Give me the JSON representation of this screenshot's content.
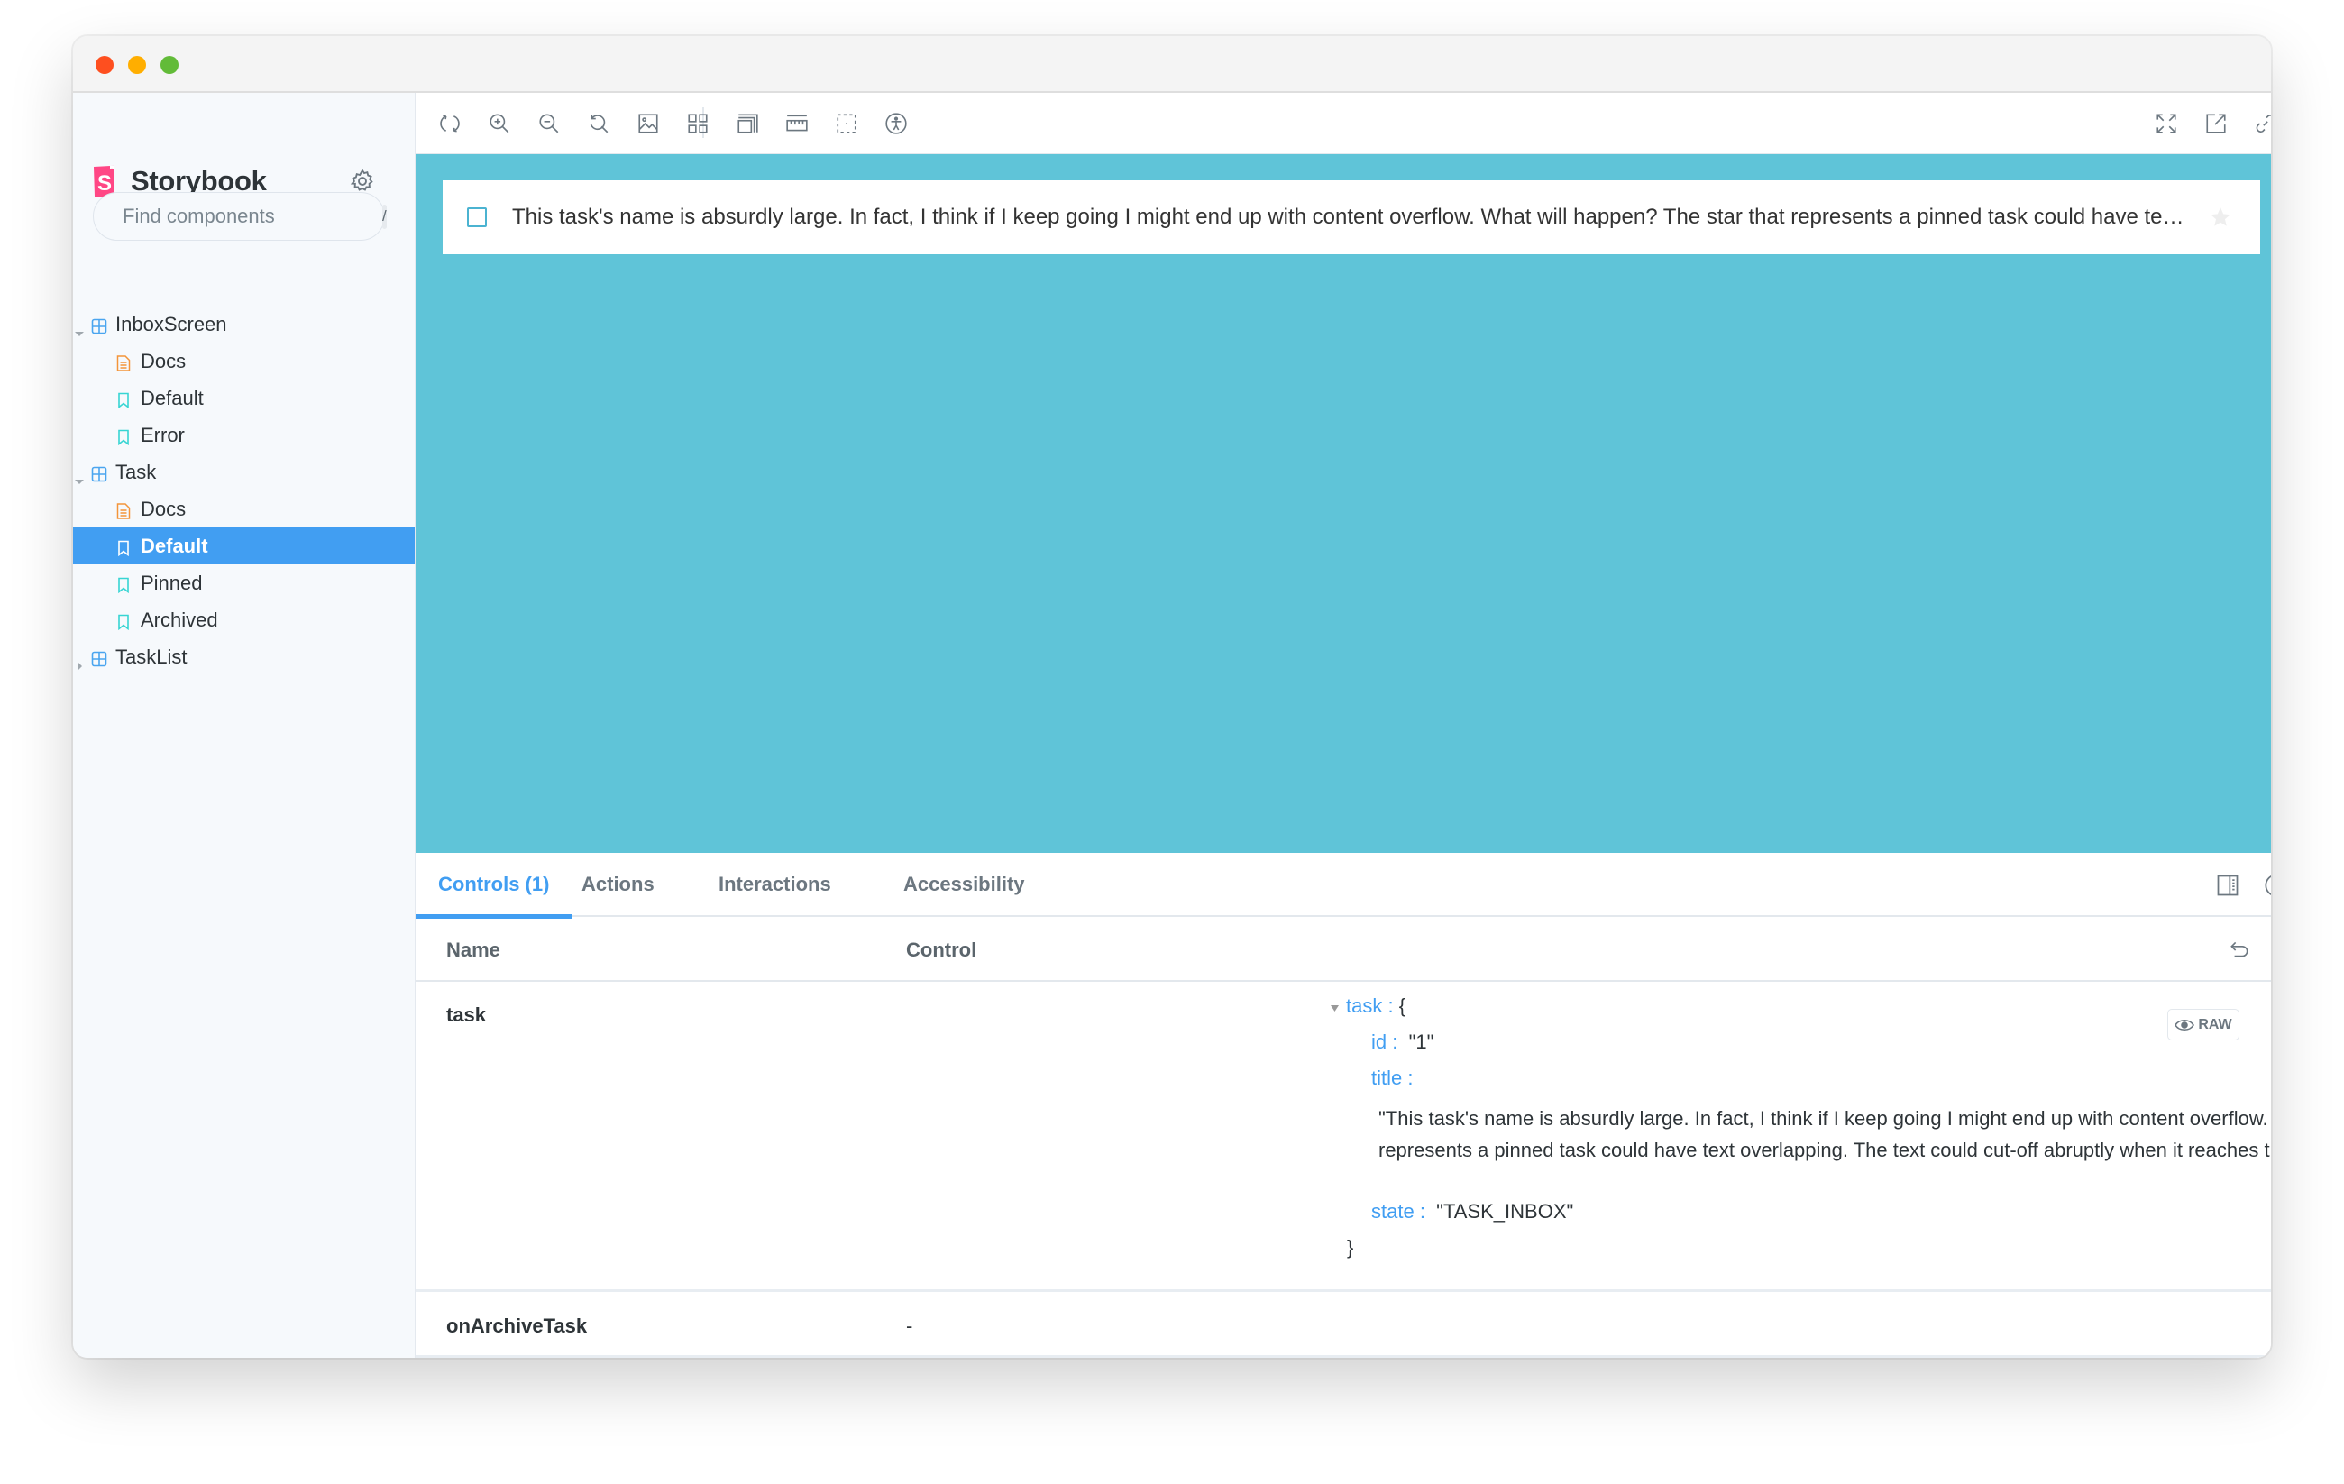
{
  "window": {
    "traffic_lights": [
      "close",
      "minimize",
      "maximize"
    ]
  },
  "sidebar": {
    "brand": "Storybook",
    "brand_icon": "storybook-logo-icon",
    "settings_icon": "gear-icon",
    "search": {
      "placeholder": "Find components",
      "value": "",
      "shortcut": "/"
    },
    "tree": [
      {
        "label": "InboxScreen",
        "type": "component",
        "level": 0,
        "expanded": true
      },
      {
        "label": "Docs",
        "type": "docs",
        "level": 1
      },
      {
        "label": "Default",
        "type": "story",
        "level": 1
      },
      {
        "label": "Error",
        "type": "story",
        "level": 1
      },
      {
        "label": "Task",
        "type": "component",
        "level": 0,
        "expanded": true
      },
      {
        "label": "Docs",
        "type": "docs",
        "level": 1
      },
      {
        "label": "Default",
        "type": "story",
        "level": 1,
        "selected": true
      },
      {
        "label": "Pinned",
        "type": "story",
        "level": 1
      },
      {
        "label": "Archived",
        "type": "story",
        "level": 1
      },
      {
        "label": "TaskList",
        "type": "component",
        "level": 0,
        "expanded": false
      }
    ]
  },
  "toolbar": {
    "left_tools": [
      "remount-icon",
      "zoom-in-icon",
      "zoom-out-icon",
      "reset-zoom-icon"
    ],
    "addon_tools": [
      "background-icon",
      "grid-icon",
      "viewport-icon",
      "measure-icon",
      "outline-icon",
      "accessibility-icon"
    ],
    "right_tools": [
      "fullscreen-icon",
      "open-new-tab-icon",
      "copy-link-icon"
    ]
  },
  "preview": {
    "background": "#5fc4d8",
    "task": {
      "checked": false,
      "title": "This task's name is absurdly large. In fact, I think if I keep going I might end up with content overflow. What will happen? The star that represents a pinned task could have text overlapping. The text could cut-off abruptly when it reaches the star. I hope not!",
      "pinned": false
    }
  },
  "panel": {
    "tabs": [
      {
        "label": "Controls (1)",
        "active": true
      },
      {
        "label": "Actions",
        "active": false
      },
      {
        "label": "Interactions",
        "active": false
      },
      {
        "label": "Accessibility",
        "active": false
      }
    ],
    "header": {
      "name": "Name",
      "control": "Control"
    },
    "rows": [
      {
        "name": "task",
        "object": {
          "root_key": "task",
          "open_brace": "{",
          "close_brace": "}",
          "id_key": "id",
          "id_value": "\"1\"",
          "title_key": "title",
          "title_value": "\"This task's name is absurdly large. In fact, I think if I keep going I might end up with content overflow. What will happen? The star that represents a pinned task could have text overlapping. The text could cut-off abruptly when it reaches the star. I hope not!\"",
          "state_key": "state",
          "state_value": "\"TASK_INBOX\""
        },
        "raw_button": "RAW"
      },
      {
        "name": "onArchiveTask",
        "control": "-"
      }
    ]
  },
  "colors": {
    "accent": "#419ef2",
    "storybook_pink": "#ff4785",
    "preview_bg": "#5fc4d8",
    "docs_icon": "#f3953a",
    "story_icon": "#37d5d3",
    "component_icon": "#4aa5ef"
  }
}
